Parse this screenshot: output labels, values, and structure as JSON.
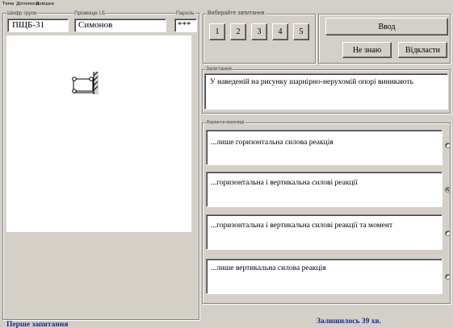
{
  "menu": {
    "items": [
      "Тема",
      "Допомога",
      "Довідка"
    ]
  },
  "fields": {
    "group_label": "Шифр групи",
    "group_value": "ПЩБ-31",
    "surname_label": "Прізвище І.Б",
    "surname_value": "Симонов",
    "password_label": "Пароль",
    "password_value": "***"
  },
  "question_select": {
    "label": "Вибирайте запитання",
    "buttons": [
      "1",
      "2",
      "3",
      "4",
      "5"
    ]
  },
  "actions": {
    "enter": "Ввод",
    "dont_know": "Не знаю",
    "skip": "Відкласти"
  },
  "question": {
    "label": "Запитання",
    "text": "У наведеній на рисунку шарнірно-нерухомій опорі виникають"
  },
  "answers": {
    "label": "Варіанти відповіді",
    "options": [
      {
        "text": "...лише горизонтальна силова реакція",
        "selected": false
      },
      {
        "text": "...горизонтальна і вертикальна силові реакції",
        "selected": true
      },
      {
        "text": "...горизонтальна і вертикальна силові реакції та момент",
        "selected": false
      },
      {
        "text": "...лише вертикальна силова реакція",
        "selected": false
      }
    ]
  },
  "status": {
    "left": "Перше запитання",
    "right": "Залишилось 39 хв."
  }
}
